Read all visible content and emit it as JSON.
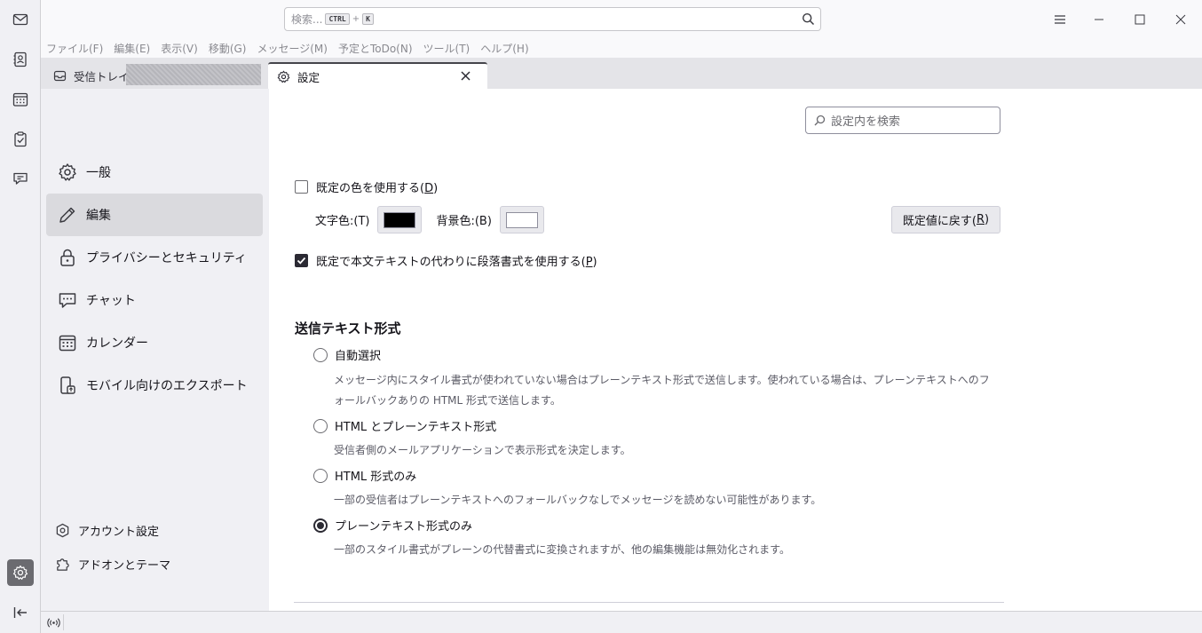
{
  "window": {
    "search_placeholder": "検索...",
    "shortcut_key1": "CTRL",
    "shortcut_plus": "+",
    "shortcut_key2": "K"
  },
  "spaces": [
    {
      "name": "mail",
      "icon": "envelope-icon"
    },
    {
      "name": "address-book",
      "icon": "address-book-icon"
    },
    {
      "name": "calendar",
      "icon": "calendar-icon"
    },
    {
      "name": "tasks",
      "icon": "tasks-icon"
    },
    {
      "name": "chat",
      "icon": "chat-icon"
    },
    {
      "name": "settings",
      "icon": "gear-icon",
      "active": true
    },
    {
      "name": "collapse",
      "icon": "collapse-icon"
    }
  ],
  "menubar": {
    "file": "ファイル(F)",
    "edit": "編集(E)",
    "view": "表示(V)",
    "go": "移動(G)",
    "message": "メッセージ(M)",
    "events": "予定とToDo(N)",
    "tools": "ツール(T)",
    "help": "ヘルプ(H)"
  },
  "tabs": {
    "inbox_label": "受信トレイ -",
    "settings_label": "設定"
  },
  "categories": {
    "general": "一般",
    "compose": "編集",
    "privacy": "プライバシーとセキュリティ",
    "chat": "チャット",
    "calendar": "カレンダー",
    "export": "モバイル向けのエクスポート",
    "account_settings": "アカウント設定",
    "addons": "アドオンとテーマ"
  },
  "main": {
    "find_placeholder": "設定内を検索",
    "use_default_colors_pre": "既定の色を使用する(",
    "use_default_colors_key": "D",
    "use_default_colors_post": ")",
    "text_color_label": "文字色:(T)",
    "bg_color_label": "背景色:(B)",
    "text_color": "#000000",
    "bg_color": "#ffffff",
    "reset_pre": "既定値に戻す(",
    "reset_key": "R",
    "reset_post": ")",
    "paragraph_pre": "既定で本文テキストの代わりに段落書式を使用する(",
    "paragraph_key": "P",
    "paragraph_post": ")",
    "use_default_colors_checked": false,
    "paragraph_checked": true,
    "send_format_title": "送信テキスト形式",
    "options": [
      {
        "label": "自動選択",
        "desc": "メッセージ内にスタイル書式が使われていない場合はプレーンテキスト形式で送信します。使われている場合は、プレーンテキストへのフォールバックありの HTML 形式で送信します。",
        "checked": false
      },
      {
        "label": "HTML とプレーンテキスト形式",
        "desc": "受信者側のメールアプリケーションで表示形式を決定します。",
        "checked": false
      },
      {
        "label": "HTML 形式のみ",
        "desc": "一部の受信者はプレーンテキストへのフォールバックなしでメッセージを読めない可能性があります。",
        "checked": false
      },
      {
        "label": "プレーンテキスト形式のみ",
        "desc": "一部のスタイル書式がプレーンの代替書式に変換されますが、他の編集機能は無効化されます。",
        "checked": true
      }
    ]
  }
}
